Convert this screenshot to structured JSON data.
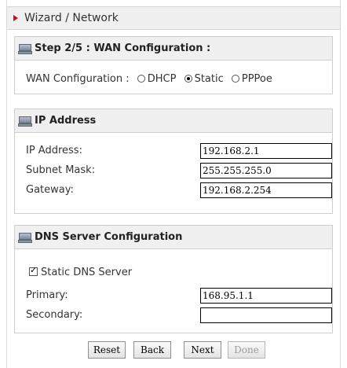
{
  "header": {
    "title": "Wizard / Network"
  },
  "wan": {
    "title": "Step 2/5 : WAN Configuration :",
    "label": "WAN Configuration :",
    "options": [
      "DHCP",
      "Static",
      "PPPoe"
    ],
    "selected": "Static"
  },
  "ip": {
    "title": "IP Address",
    "fields": [
      {
        "label": "IP Address:",
        "value": "192.168.2.1"
      },
      {
        "label": "Subnet Mask:",
        "value": "255.255.255.0"
      },
      {
        "label": "Gateway:",
        "value": "192.168.2.254"
      }
    ]
  },
  "dns": {
    "title": "DNS Server Configuration",
    "static_label": "Static DNS Server",
    "static_checked": true,
    "primary_label": "Primary:",
    "primary_value": "168.95.1.1",
    "secondary_label": "Secondary:",
    "secondary_value": ""
  },
  "buttons": {
    "reset": "Reset",
    "back": "Back",
    "next": "Next",
    "done": "Done"
  },
  "colors": {
    "accent": "#d01010",
    "panel": "#f0f0f0",
    "border": "#cfcfcf"
  }
}
